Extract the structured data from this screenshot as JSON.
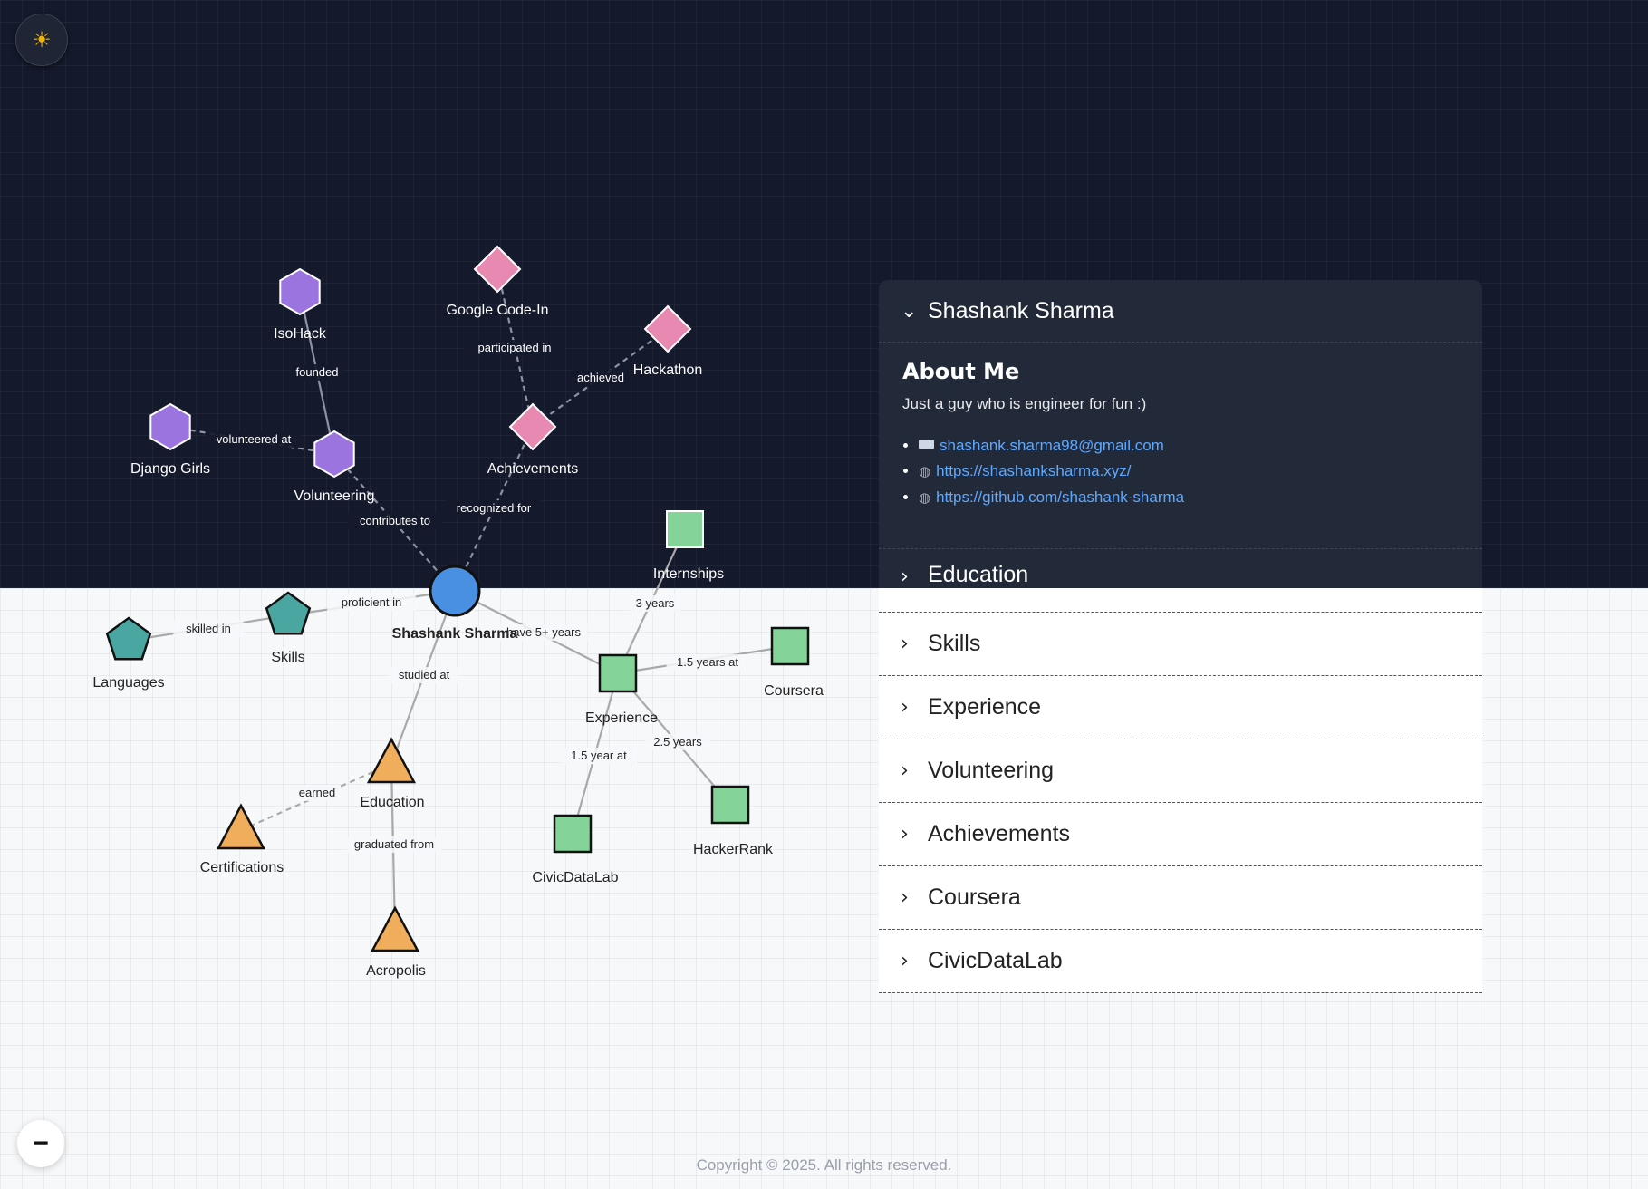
{
  "theme_toggle": {
    "icon": "sun-icon",
    "glyph": "☀"
  },
  "zoom_out": {
    "icon": "minus-icon",
    "glyph": "−"
  },
  "footer": {
    "text": "Copyright © 2025. All rights reserved."
  },
  "panel": {
    "title": "Shashank Sharma",
    "about": {
      "heading": "About Me",
      "tagline": "Just a guy who is engineer for fun :)",
      "links": [
        {
          "icon": "email-icon",
          "text": "shashank.sharma98@gmail.com"
        },
        {
          "icon": "globe-icon",
          "text": "https://shashanksharma.xyz/"
        },
        {
          "icon": "globe-icon",
          "text": "https://github.com/shashank-sharma"
        }
      ]
    },
    "sections": [
      "Education",
      "Skills",
      "Experience",
      "Volunteering",
      "Achievements",
      "Coursera",
      "CivicDataLab"
    ]
  },
  "colors": {
    "hexagon": "#9b74e0",
    "diamond": "#e889b2",
    "pentagon": "#4aa6a0",
    "square": "#84d49a",
    "triangle": "#f0ad5c",
    "center": "#4a90e2",
    "link": "#5ea9ff"
  },
  "graph": {
    "nodes": [
      {
        "id": "isohack",
        "label": "IsoHack",
        "shape": "hexagon"
      },
      {
        "id": "django",
        "label": "Django Girls",
        "shape": "hexagon"
      },
      {
        "id": "volunteering",
        "label": "Volunteering",
        "shape": "hexagon"
      },
      {
        "id": "gci",
        "label": "Google Code-In",
        "shape": "diamond"
      },
      {
        "id": "hackathon",
        "label": "Hackathon",
        "shape": "diamond"
      },
      {
        "id": "achievements",
        "label": "Achievements",
        "shape": "diamond"
      },
      {
        "id": "center",
        "label": "Shashank Sharma",
        "shape": "circle"
      },
      {
        "id": "skills",
        "label": "Skills",
        "shape": "pentagon"
      },
      {
        "id": "languages",
        "label": "Languages",
        "shape": "pentagon"
      },
      {
        "id": "internships",
        "label": "Internships",
        "shape": "square"
      },
      {
        "id": "experience",
        "label": "Experience",
        "shape": "square"
      },
      {
        "id": "coursera",
        "label": "Coursera",
        "shape": "square"
      },
      {
        "id": "civic",
        "label": "CivicDataLab",
        "shape": "square"
      },
      {
        "id": "hackerrank",
        "label": "HackerRank",
        "shape": "square"
      },
      {
        "id": "education",
        "label": "Education",
        "shape": "triangle"
      },
      {
        "id": "certs",
        "label": "Certifications",
        "shape": "triangle"
      },
      {
        "id": "acropolis",
        "label": "Acropolis",
        "shape": "triangle"
      }
    ],
    "edges": [
      {
        "from": "isohack",
        "to": "volunteering",
        "label": "founded",
        "dashed": false
      },
      {
        "from": "django",
        "to": "volunteering",
        "label": "volunteered at",
        "dashed": true
      },
      {
        "from": "volunteering",
        "to": "center",
        "label": "contributes to",
        "dashed": true
      },
      {
        "from": "gci",
        "to": "achievements",
        "label": "participated in",
        "dashed": true
      },
      {
        "from": "hackathon",
        "to": "achievements",
        "label": "achieved",
        "dashed": true
      },
      {
        "from": "achievements",
        "to": "center",
        "label": "recognized for",
        "dashed": true
      },
      {
        "from": "center",
        "to": "skills",
        "label": "proficient in",
        "dashed": false
      },
      {
        "from": "skills",
        "to": "languages",
        "label": "skilled in",
        "dashed": false
      },
      {
        "from": "center",
        "to": "experience",
        "label": "have 5+ years",
        "dashed": false
      },
      {
        "from": "center",
        "to": "education",
        "label": "studied at",
        "dashed": false
      },
      {
        "from": "experience",
        "to": "internships",
        "label": "3 years",
        "dashed": false
      },
      {
        "from": "experience",
        "to": "coursera",
        "label": "1.5 years at",
        "dashed": false
      },
      {
        "from": "experience",
        "to": "civic",
        "label": "1.5 year at",
        "dashed": false
      },
      {
        "from": "experience",
        "to": "hackerrank",
        "label": "2.5 years",
        "dashed": false
      },
      {
        "from": "education",
        "to": "certs",
        "label": "earned",
        "dashed": true
      },
      {
        "from": "education",
        "to": "acropolis",
        "label": "graduated from",
        "dashed": false
      }
    ]
  }
}
